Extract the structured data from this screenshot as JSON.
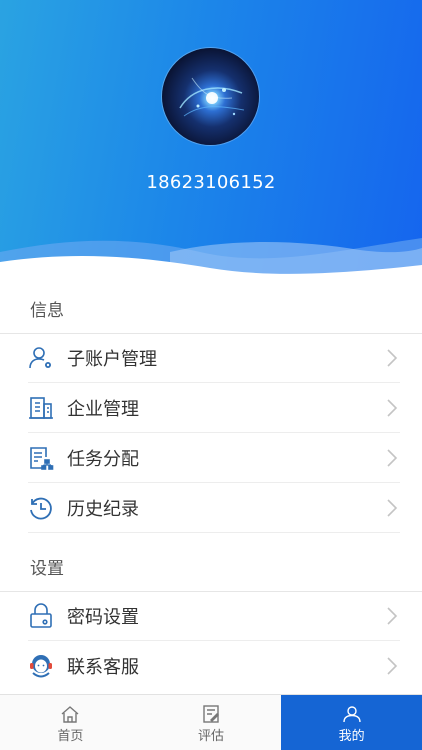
{
  "profile": {
    "phone": "18623106152"
  },
  "sections": {
    "info_title": "信息",
    "settings_title": "设置"
  },
  "info_items": [
    {
      "label": "子账户管理",
      "icon": "sub-account-icon"
    },
    {
      "label": "企业管理",
      "icon": "building-icon"
    },
    {
      "label": "任务分配",
      "icon": "task-assign-icon"
    },
    {
      "label": "历史纪录",
      "icon": "history-icon"
    }
  ],
  "settings_items": [
    {
      "label": "密码设置",
      "icon": "lock-icon"
    },
    {
      "label": "联系客服",
      "icon": "customer-service-icon"
    }
  ],
  "tabbar": {
    "items": [
      {
        "label": "首页",
        "icon": "home-icon"
      },
      {
        "label": "评估",
        "icon": "evaluate-icon"
      },
      {
        "label": "我的",
        "icon": "user-icon"
      }
    ],
    "active_index": 2
  },
  "colors": {
    "accent": "#1565d4",
    "icon_blue": "#2f6fb5",
    "header_start": "#2aa3e2",
    "header_end": "#1565ee"
  }
}
